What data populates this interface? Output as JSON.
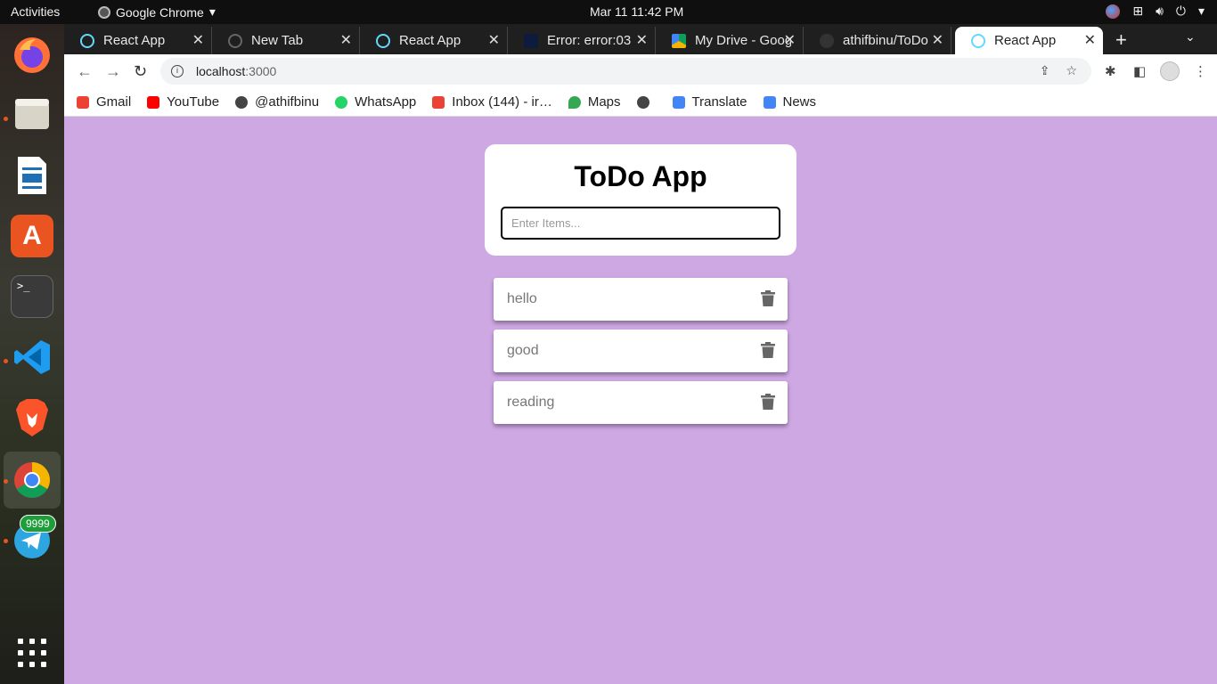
{
  "system": {
    "activities": "Activities",
    "app_name": "Google Chrome",
    "app_menu_arrow": "▾",
    "clock": "Mar 11  11:42 PM"
  },
  "dock": {
    "items": [
      "firefox-icon",
      "files-icon",
      "writer-icon",
      "software-icon",
      "terminal-icon",
      "vscode-icon",
      "brave-icon",
      "chrome-icon",
      "telegram-icon"
    ],
    "telegram_badge": "9999"
  },
  "tabs": [
    {
      "title": "React App",
      "favicon": "react"
    },
    {
      "title": "New Tab",
      "favicon": "newtab"
    },
    {
      "title": "React App",
      "favicon": "react"
    },
    {
      "title": "Error: error:03",
      "favicon": "err"
    },
    {
      "title": "My Drive - Goog",
      "favicon": "drive"
    },
    {
      "title": "athifbinu/ToDo",
      "favicon": "gh"
    },
    {
      "title": "React App",
      "favicon": "react",
      "active": true
    }
  ],
  "address": {
    "host": "localhost",
    "port": ":3000"
  },
  "bookmarks": [
    {
      "label": "Gmail",
      "color": "#ea4335"
    },
    {
      "label": "YouTube",
      "color": "#ff0000"
    },
    {
      "label": "@athifbinu",
      "color": "#444444"
    },
    {
      "label": "WhatsApp",
      "color": "#25d366"
    },
    {
      "label": "Inbox (144) - ir…",
      "color": "#ea4335"
    },
    {
      "label": "Maps",
      "color": "#34a853"
    },
    {
      "label": "",
      "color": "#444444"
    },
    {
      "label": "Translate",
      "color": "#4285f4"
    },
    {
      "label": "News",
      "color": "#4285f4"
    }
  ],
  "app": {
    "title": "ToDo App",
    "input_placeholder": "Enter Items...",
    "items": [
      "hello",
      "good",
      "reading"
    ],
    "background": "#cea8e3"
  }
}
